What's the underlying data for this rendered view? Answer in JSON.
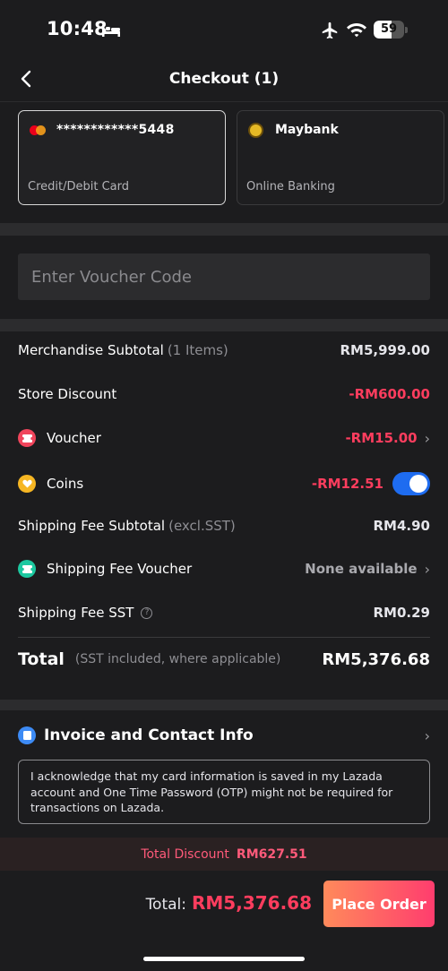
{
  "status_bar": {
    "time": "10:48",
    "battery": "59",
    "battery_level": 0.59
  },
  "header": {
    "title": "Checkout (1)"
  },
  "payment": {
    "card": {
      "number": "************5448",
      "label": "Credit/Debit Card"
    },
    "bank": {
      "name": "Maybank",
      "label": "Online Banking"
    }
  },
  "voucher_input": {
    "placeholder": "Enter Voucher Code",
    "value": ""
  },
  "summary": {
    "merch_label": "Merchandise Subtotal",
    "merch_count": "(1 Items)",
    "merch_value": "RM5,999.00",
    "store_discount_label": "Store Discount",
    "store_discount_value": "-RM600.00",
    "voucher_label": "Voucher",
    "voucher_value": "-RM15.00",
    "coins_label": "Coins",
    "coins_value": "-RM12.51",
    "coins_enabled": true,
    "shipping_label": "Shipping Fee Subtotal",
    "shipping_note": "(excl.SST)",
    "shipping_value": "RM4.90",
    "ship_voucher_label": "Shipping Fee Voucher",
    "ship_voucher_value": "None available",
    "ship_sst_label": "Shipping Fee SST",
    "ship_sst_value": "RM0.29",
    "total_label": "Total",
    "total_note": "(SST included, where applicable)",
    "total_value": "RM5,376.68"
  },
  "invoice": {
    "title": "Invoice and Contact Info",
    "notice": "I acknowledge that my card information is saved in my Lazada account and One Time Password (OTP) might not be required for transactions on Lazada."
  },
  "discount_band": {
    "label": "Total Discount",
    "value": "RM627.51"
  },
  "bottom_bar": {
    "total_label": "Total:",
    "total_value": "RM5,376.68",
    "place_order": "Place Order"
  },
  "colors": {
    "accent_red": "#ff3d5e",
    "toggle_blue": "#1e6cf0",
    "coins_gold": "#f6b623",
    "voucher_red": "#f0455c",
    "shipping_teal": "#1cc8a0",
    "invoice_blue": "#3d8bf5"
  }
}
